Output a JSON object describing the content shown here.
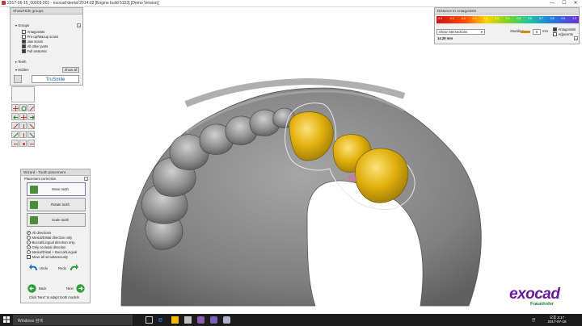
{
  "window": {
    "title": "2017-06-15_00003-001 - exocad dental 2014.02 [Engine build 5153] [Demo Version]",
    "minimize": "—",
    "maximize": "☐",
    "close": "✕"
  },
  "groups_panel": {
    "header": "Show/Hide groups",
    "groups_label": "Groups",
    "help": "?",
    "items": [
      {
        "label": "Antagonists",
        "checked": false
      },
      {
        "label": "Pre-op/Waxup scans",
        "checked": false
      },
      {
        "label": "Jaw scans",
        "checked": true
      },
      {
        "label": "All other parts",
        "checked": true
      },
      {
        "label": "Full anatomic",
        "checked": true
      }
    ],
    "teeth_label": "Teeth",
    "hidden_label": "Hidden",
    "show_all": "Show all",
    "trusmile": "TruSmile"
  },
  "distance_panel": {
    "header": "Distance to Antagonists",
    "scale_labels": [
      "-0.4",
      "-0.2",
      "0.0",
      "0.1",
      "0.2",
      "0.3",
      "0.4",
      "0.5",
      "0.6",
      "0.7",
      "0.8",
      "0.9",
      "1.0"
    ],
    "intersections_label": "Show intersections",
    "studding_label": "Studding",
    "studding_value": "5",
    "studding_unit": "mm",
    "antagonists": "Antagonists",
    "adjacents": "Adjacents",
    "distance_value": "14.29 mm",
    "help": "?"
  },
  "wizard": {
    "header": "Wizard - Tooth placement",
    "section": "Placement correction",
    "help": "?",
    "move_tooth": "Move tooth",
    "rotate_tooth": "Rotate tooth",
    "scale_tooth": "Scale tooth",
    "options": [
      {
        "label": "All directions",
        "selected": true
      },
      {
        "label": "Mesial/Distal direction only",
        "selected": false
      },
      {
        "label": "Buccal/Lingual direction only",
        "selected": false
      },
      {
        "label": "Only occlusal direction",
        "selected": false
      },
      {
        "label": "Mesial/Distal + Buccal/Lingual",
        "selected": false
      }
    ],
    "move_all": "Move all simultaneously",
    "undo": "Undo",
    "redo": "Redo",
    "back": "Back",
    "next": "Next",
    "footer": "Click 'Next' to adapt tooth models"
  },
  "logo": {
    "word": "exocad",
    "sub": "Fraunhofer"
  },
  "taskbar": {
    "search_text": "Windows 검색",
    "lang": "한",
    "time": "오후 3:17",
    "date": "2017-07-18"
  },
  "colors": {
    "crown": "#e3b20f",
    "model": "#8a8a8a",
    "accent_wizard": "#2e7d32",
    "logo": "#6a1b9a"
  }
}
